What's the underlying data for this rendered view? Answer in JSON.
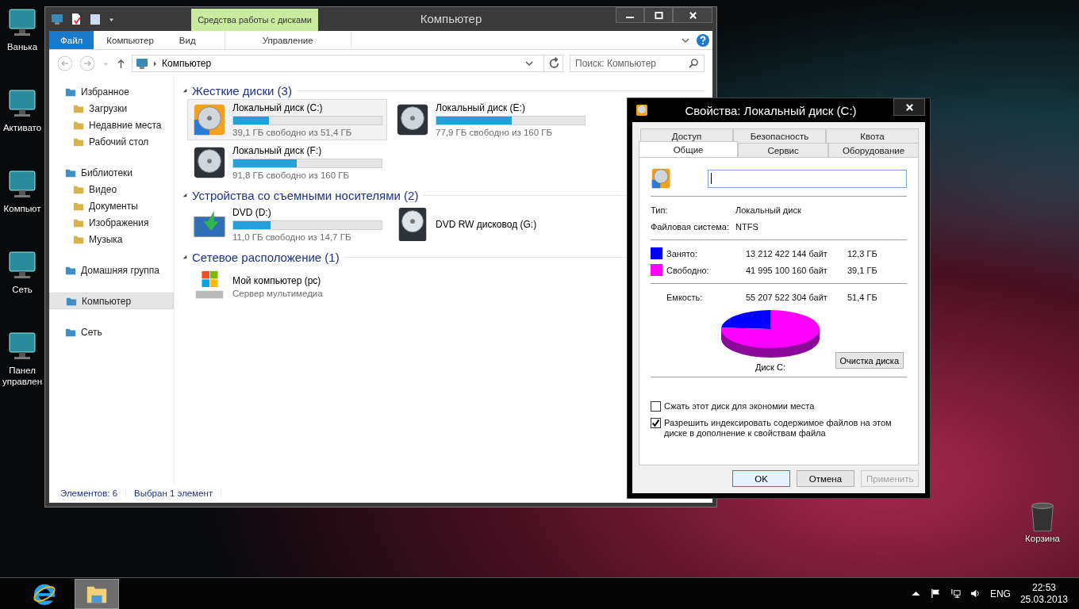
{
  "desktop_icons": [
    {
      "label": "Ванька"
    },
    {
      "label": "Активато"
    },
    {
      "label": "Компьют"
    },
    {
      "label": "Сеть"
    },
    {
      "label": "Панел управлен"
    }
  ],
  "recycle_bin": {
    "label": "Корзина"
  },
  "explorer": {
    "title": "Компьютер",
    "context_group": "Средства работы с дисками",
    "ribbon_tabs": [
      {
        "label": "Файл",
        "kind": "file"
      },
      {
        "label": "Компьютер",
        "kind": "normal"
      },
      {
        "label": "Вид",
        "kind": "normal"
      },
      {
        "label": "Управление",
        "kind": "context"
      }
    ],
    "address": {
      "path": "Компьютер"
    },
    "search": {
      "placeholder": "Поиск: Компьютер"
    },
    "nav": [
      {
        "label": "Избранное",
        "selected": false,
        "children": [
          {
            "label": "Загрузки",
            "selected": false
          },
          {
            "label": "Недавние места",
            "selected": false
          },
          {
            "label": "Рабочий стол",
            "selected": false
          }
        ]
      },
      {
        "label": "Библиотеки",
        "selected": false,
        "children": [
          {
            "label": "Видео",
            "selected": false
          },
          {
            "label": "Документы",
            "selected": false
          },
          {
            "label": "Изображения",
            "selected": false
          },
          {
            "label": "Музыка",
            "selected": false
          }
        ]
      },
      {
        "label": "Домашняя группа",
        "selected": false
      },
      {
        "label": "Компьютер",
        "selected": true
      },
      {
        "label": "Сеть",
        "selected": false
      }
    ],
    "groups": [
      {
        "title": "Жесткие диски (3)",
        "items": [
          {
            "name": "Локальный диск (C:)",
            "kind": "system-drive",
            "level": 0.24,
            "info": "39,1 ГБ свободно из 51,4 ГБ",
            "selected": true
          },
          {
            "name": "Локальный диск (E:)",
            "kind": "drive",
            "level": 0.51,
            "info": "77,9 ГБ свободно из 160 ГБ",
            "selected": false
          },
          {
            "name": "Локальный диск (F:)",
            "kind": "drive",
            "level": 0.43,
            "info": "91,8 ГБ свободно из 160 ГБ",
            "selected": false
          }
        ]
      },
      {
        "title": "Устройства со съемными носителями (2)",
        "items": [
          {
            "name": "DVD (D:)",
            "kind": "dvd-media",
            "level": 0.25,
            "info": "11,0 ГБ свободно из 14,7 ГБ",
            "selected": false
          },
          {
            "name": "DVD RW дисковод (G:)",
            "kind": "dvd-drive",
            "selected": false
          }
        ]
      },
      {
        "title": "Сетевое расположение (1)",
        "items": [
          {
            "name": "Мой компьютер (pc)",
            "kind": "media-server",
            "info": "Сервер мультимедиа",
            "selected": false
          }
        ]
      }
    ],
    "status_bar": [
      "Элементов: 6",
      "Выбран 1 элемент"
    ]
  },
  "dialog": {
    "title": "Свойства: Локальный диск (C:)",
    "tab_rows": [
      [
        {
          "label": "Доступ",
          "selected": false
        },
        {
          "label": "Безопасность",
          "selected": false
        },
        {
          "label": "Квота",
          "selected": false
        }
      ],
      [
        {
          "label": "Общие",
          "selected": true
        },
        {
          "label": "Сервис",
          "selected": false
        },
        {
          "label": "Оборудование",
          "selected": false
        }
      ]
    ],
    "properties": [
      {
        "label": "Тип:",
        "value": "Локальный диск"
      },
      {
        "label": "Файловая система:",
        "value": "NTFS"
      }
    ],
    "usage": [
      {
        "label": "Занято:",
        "bytes": "13 212 422 144 байт",
        "size": "12,3 ГБ",
        "color": "#0000ff"
      },
      {
        "label": "Свободно:",
        "bytes": "41 995 100 160 байт",
        "size": "39,1 ГБ",
        "color": "#ff00ff"
      }
    ],
    "capacity": {
      "label": "Емкость:",
      "bytes": "55 207 522 304 байт",
      "size": "51,4 ГБ"
    },
    "pie": {
      "caption": "Диск C:",
      "chart_data": {
        "type": "pie",
        "values": [
          23.9,
          76.1
        ]
      }
    },
    "cleanup_button": "Очистка диска",
    "checkboxes": [
      {
        "label": "Сжать этот диск для экономии места",
        "checked": false
      },
      {
        "label": "Разрешить индексировать содержимое файлов на этом диске в дополнение к свойствам файла",
        "checked": true
      }
    ],
    "buttons": [
      {
        "label": "OK",
        "default": true,
        "disabled": false
      },
      {
        "label": "Отмена",
        "default": false,
        "disabled": false
      },
      {
        "label": "Применить",
        "default": false,
        "disabled": true
      }
    ]
  },
  "taskbar": {
    "apps": [
      {
        "kind": "browser",
        "selected": false
      },
      {
        "kind": "explorer",
        "selected": true
      }
    ],
    "language": "ENG",
    "time": "22:53",
    "date": "25.03.2013"
  }
}
